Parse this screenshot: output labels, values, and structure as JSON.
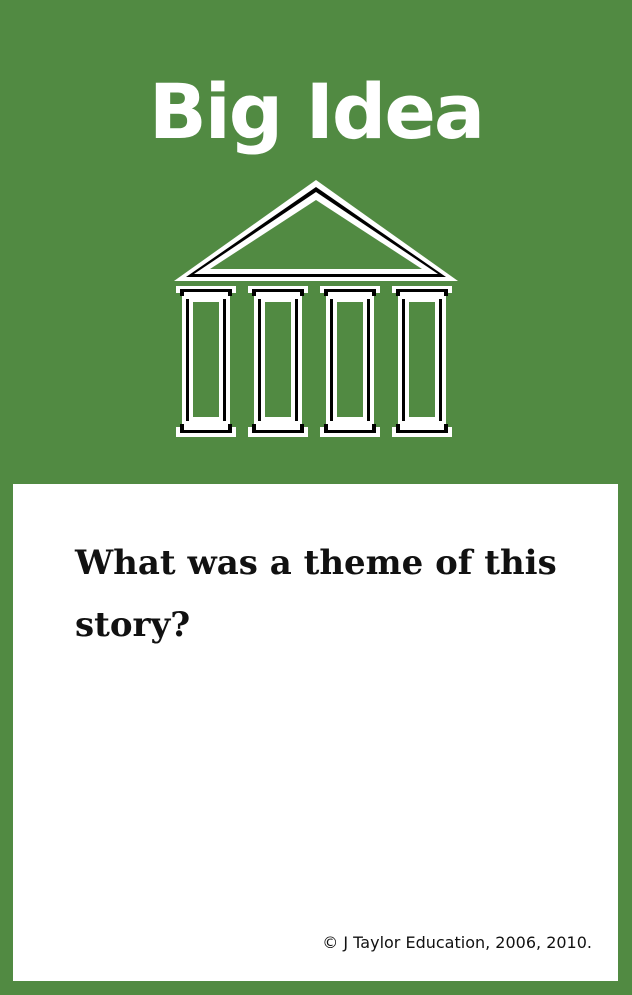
{
  "card": {
    "title": "Big Idea",
    "icon": "temple-icon",
    "question": "What was a theme of this story?",
    "copyright": "© J Taylor Education, 2006, 2010.",
    "colors": {
      "background": "#518a42",
      "panel": "#ffffff",
      "text": "#111111",
      "title": "#ffffff"
    }
  }
}
